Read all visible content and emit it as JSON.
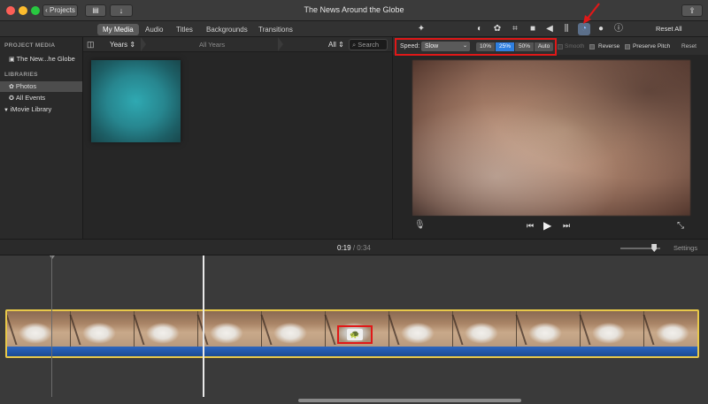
{
  "window": {
    "title": "The News Around the Globe",
    "projects_button": "Projects"
  },
  "media_tabs": [
    "My Media",
    "Audio",
    "Titles",
    "Backgrounds",
    "Transitions"
  ],
  "adjust_icons": [
    "magic-wand-icon",
    "color-balance-icon",
    "color-correction-icon",
    "crop-icon",
    "stabilization-icon",
    "volume-icon",
    "equalizer-icon",
    "speed-icon",
    "noise-reduction-icon",
    "info-icon"
  ],
  "reset_all": "Reset All",
  "sidebar": {
    "project_media_header": "PROJECT MEDIA",
    "project_item": "The New...he Globe",
    "libraries_header": "LIBRARIES",
    "items": [
      "Photos",
      "All Events",
      "iMovie Library"
    ]
  },
  "browser": {
    "group_by": "Years",
    "range": "All Years",
    "filter": "All",
    "search_placeholder": "Search"
  },
  "speed": {
    "label": "Speed:",
    "value": "Slow",
    "options": [
      "10%",
      "25%",
      "50%",
      "Auto"
    ],
    "selected_option": "25%",
    "smooth_label": "Smooth",
    "reverse_label": "Reverse",
    "preserve_pitch_label": "Preserve Pitch",
    "reset_label": "Reset"
  },
  "timeline": {
    "current_time": "0:19",
    "separator": "/",
    "total_time": "0:34",
    "settings_label": "Settings",
    "zoom_level": 0.85
  },
  "colors": {
    "annotation_red": "#e01818",
    "accent_blue": "#2f7fe0",
    "clip_border": "#e8c84a"
  }
}
